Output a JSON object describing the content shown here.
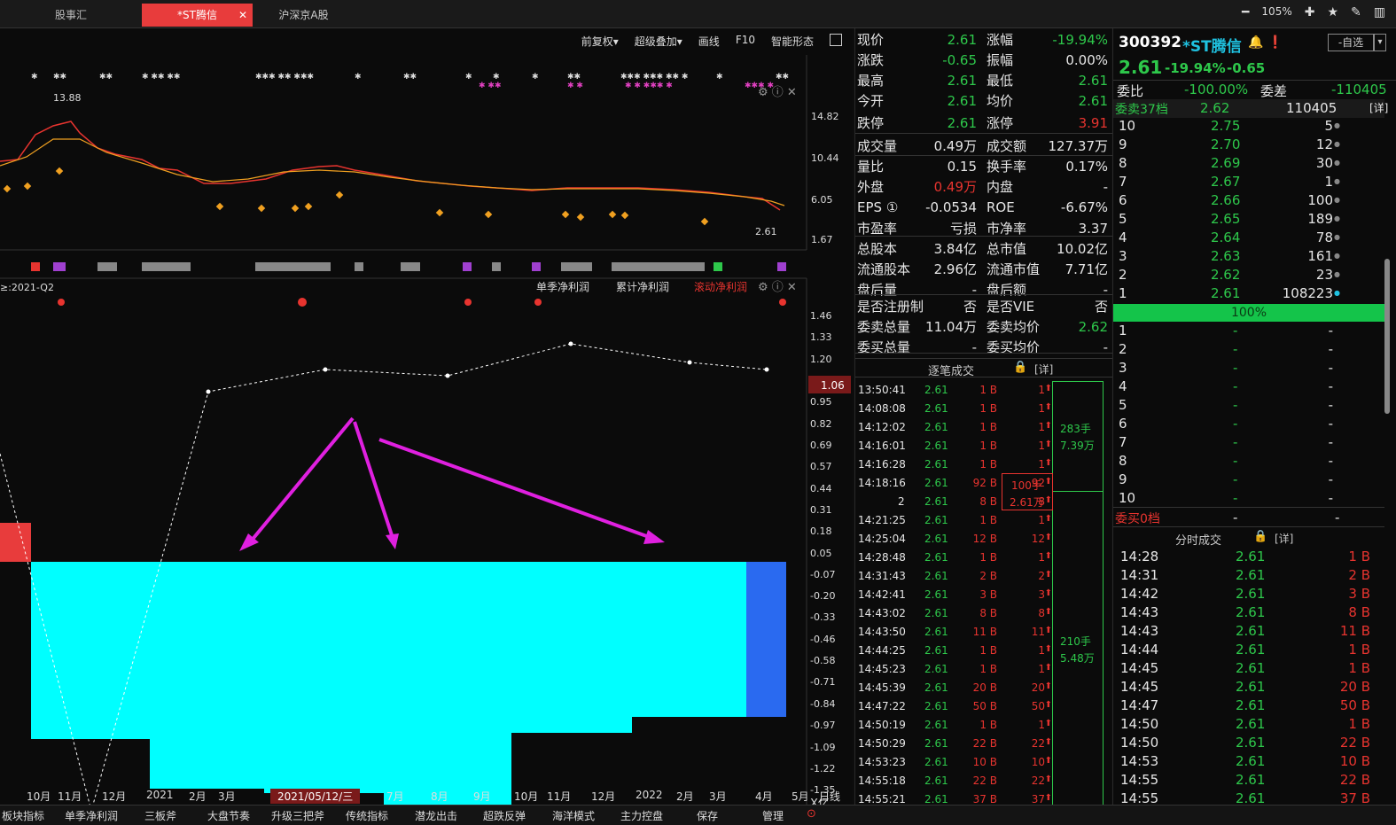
{
  "tabs": {
    "t1": "股事汇",
    "t2": "*ST腾信",
    "t3": "沪深京A股"
  },
  "window": {
    "zoom": "105%"
  },
  "toolbar": {
    "fq": "前复权▾",
    "overlay": "超级叠加▾",
    "draw": "画线",
    "f10": "F10",
    "smart": "智能形态"
  },
  "kchart": {
    "price_axis": [
      "14.82",
      "10.44",
      "6.05",
      "1.67"
    ],
    "high_label": "13.88",
    "last_label": "2.61"
  },
  "fin": {
    "period": "≥:2021-Q2",
    "tab1": "单季净利润",
    "tab2": "累计净利润",
    "tab3": "滚动净利润",
    "highlight": "1.06",
    "unit": "X亿",
    "axis": [
      "1.46",
      "1.33",
      "1.20",
      "1.06",
      "0.95",
      "0.82",
      "0.69",
      "0.57",
      "0.44",
      "0.31",
      "0.18",
      "0.05",
      "-0.07",
      "-0.20",
      "-0.33",
      "-0.46",
      "-0.58",
      "-0.71",
      "-0.84",
      "-0.97",
      "-1.09",
      "-1.22",
      "-1.35"
    ]
  },
  "timeaxis": [
    "10月",
    "11月",
    "12月",
    "2021",
    "2月",
    "3月",
    "2021/05/12/三",
    "7月",
    "8月",
    "9月",
    "10月",
    "11月",
    "12月",
    "2022",
    "2月",
    "3月",
    "4月",
    "5月",
    "日线"
  ],
  "bottom": [
    "板块指标",
    "单季净利润",
    "三板斧",
    "大盘节奏",
    "升级三把斧",
    "传统指标",
    "潜龙出击",
    "超跌反弹",
    "海洋模式",
    "主力控盘",
    "保存",
    "管理"
  ],
  "quote": {
    "rows": [
      [
        "现价",
        "2.61",
        "涨幅",
        "-19.94%"
      ],
      [
        "涨跌",
        "-0.65",
        "振幅",
        "0.00%"
      ],
      [
        "最高",
        "2.61",
        "最低",
        "2.61"
      ],
      [
        "今开",
        "2.61",
        "均价",
        "2.61"
      ],
      [
        "跌停",
        "2.61",
        "涨停",
        "3.91"
      ],
      [
        "成交量",
        "0.49万",
        "成交额",
        "127.37万"
      ],
      [
        "量比",
        "0.15",
        "换手率",
        "0.17%"
      ],
      [
        "外盘",
        "0.49万",
        "内盘",
        "-"
      ],
      [
        "EPS ①",
        "-0.0534",
        "ROE",
        "-6.67%"
      ],
      [
        "市盈率",
        "亏损",
        "市净率",
        "3.37"
      ],
      [
        "总股本",
        "3.84亿",
        "总市值",
        "10.02亿"
      ],
      [
        "流通股本",
        "2.96亿",
        "流通市值",
        "7.71亿"
      ],
      [
        "盘后量",
        "-",
        "盘后额",
        "-"
      ],
      [
        "是否注册制",
        "否",
        "是否VIE",
        "否"
      ],
      [
        "委卖总量",
        "11.04万",
        "委卖均价",
        "2.62"
      ],
      [
        "委买总量",
        "-",
        "委买均价",
        "-"
      ]
    ]
  },
  "ticks": {
    "title": "逐笔成交",
    "detail": "[详]",
    "box1a": "283手",
    "box1b": "7.39万",
    "box2a": "100手",
    "box2b": "2.61万",
    "box3a": "210手",
    "box3b": "5.48万",
    "rows": [
      [
        "13:50:41",
        "2.61",
        "1 B",
        "1"
      ],
      [
        "14:08:08",
        "2.61",
        "1 B",
        "1"
      ],
      [
        "14:12:02",
        "2.61",
        "1 B",
        "1"
      ],
      [
        "14:16:01",
        "2.61",
        "1 B",
        "1"
      ],
      [
        "14:16:28",
        "2.61",
        "1 B",
        "1"
      ],
      [
        "14:18:16",
        "2.61",
        "92 B",
        "92"
      ],
      [
        "2",
        "2.61",
        "8 B",
        "8"
      ],
      [
        "14:21:25",
        "2.61",
        "1 B",
        "1"
      ],
      [
        "14:25:04",
        "2.61",
        "12 B",
        "12"
      ],
      [
        "14:28:48",
        "2.61",
        "1 B",
        "1"
      ],
      [
        "14:31:43",
        "2.61",
        "2 B",
        "2"
      ],
      [
        "14:42:41",
        "2.61",
        "3 B",
        "3"
      ],
      [
        "14:43:02",
        "2.61",
        "8 B",
        "8"
      ],
      [
        "14:43:50",
        "2.61",
        "11 B",
        "11"
      ],
      [
        "14:44:25",
        "2.61",
        "1 B",
        "1"
      ],
      [
        "14:45:23",
        "2.61",
        "1 B",
        "1"
      ],
      [
        "14:45:39",
        "2.61",
        "20 B",
        "20"
      ],
      [
        "14:47:22",
        "2.61",
        "50 B",
        "50"
      ],
      [
        "14:50:19",
        "2.61",
        "1 B",
        "1"
      ],
      [
        "14:50:29",
        "2.61",
        "22 B",
        "22"
      ],
      [
        "14:53:23",
        "2.61",
        "10 B",
        "10"
      ],
      [
        "14:55:18",
        "2.61",
        "22 B",
        "22"
      ],
      [
        "14:55:21",
        "2.61",
        "37 B",
        "37"
      ]
    ]
  },
  "stock": {
    "code": "300392",
    "name": "*ST腾信",
    "price": "2.61",
    "pct": "-19.94%",
    "chg": "-0.65",
    "watch": "-自选"
  },
  "book": {
    "wb_label": "委比",
    "wb": "-100.00%",
    "wc_label": "委差",
    "wc": "-110405",
    "sell_label": "委卖37档",
    "sell_price": "2.62",
    "sell_vol": "110405",
    "detail": "[详]",
    "asks": [
      [
        "10",
        "2.75",
        "5"
      ],
      [
        "9",
        "2.70",
        "12"
      ],
      [
        "8",
        "2.69",
        "30"
      ],
      [
        "7",
        "2.67",
        "1"
      ],
      [
        "6",
        "2.66",
        "100"
      ],
      [
        "5",
        "2.65",
        "189"
      ],
      [
        "4",
        "2.64",
        "78"
      ],
      [
        "3",
        "2.63",
        "161"
      ],
      [
        "2",
        "2.62",
        "23"
      ],
      [
        "1",
        "2.61",
        "108223"
      ]
    ],
    "bar": "100%",
    "bids": [
      [
        "1",
        "-",
        "-"
      ],
      [
        "2",
        "-",
        "-"
      ],
      [
        "3",
        "-",
        "-"
      ],
      [
        "4",
        "-",
        "-"
      ],
      [
        "5",
        "-",
        "-"
      ],
      [
        "6",
        "-",
        "-"
      ],
      [
        "7",
        "-",
        "-"
      ],
      [
        "8",
        "-",
        "-"
      ],
      [
        "9",
        "-",
        "-"
      ],
      [
        "10",
        "-",
        "-"
      ]
    ],
    "buy_label": "委买0档",
    "buy_price": "-",
    "buy_vol": "-"
  },
  "fenshi": {
    "title": "分时成交",
    "detail": "[详]",
    "rows": [
      [
        "14:28",
        "2.61",
        "1 B"
      ],
      [
        "14:31",
        "2.61",
        "2 B"
      ],
      [
        "14:42",
        "2.61",
        "3 B"
      ],
      [
        "14:43",
        "2.61",
        "8 B"
      ],
      [
        "14:43",
        "2.61",
        "11 B"
      ],
      [
        "14:44",
        "2.61",
        "1 B"
      ],
      [
        "14:45",
        "2.61",
        "1 B"
      ],
      [
        "14:45",
        "2.61",
        "20 B"
      ],
      [
        "14:47",
        "2.61",
        "50 B"
      ],
      [
        "14:50",
        "2.61",
        "1 B"
      ],
      [
        "14:50",
        "2.61",
        "22 B"
      ],
      [
        "14:53",
        "2.61",
        "10 B"
      ],
      [
        "14:55",
        "2.61",
        "22 B"
      ],
      [
        "14:55",
        "2.61",
        "37 B"
      ]
    ]
  }
}
